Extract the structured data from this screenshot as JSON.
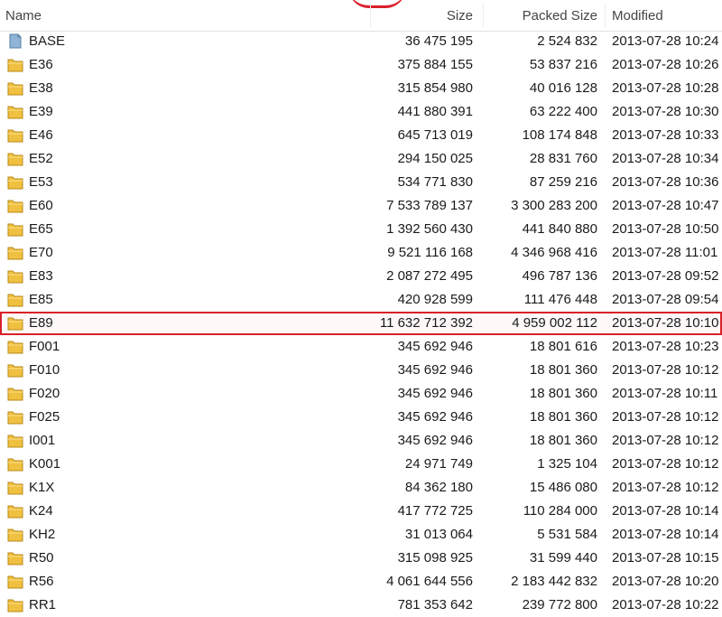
{
  "columns": {
    "name": "Name",
    "size": "Size",
    "packed_size": "Packed Size",
    "modified": "Modified"
  },
  "colors": {
    "folder": "#f0c040",
    "file": "#8fb4d6",
    "highlight": "#d9202a"
  },
  "rows": [
    {
      "name": "BASE",
      "size": "36 475 195",
      "packed": "2 524 832",
      "modified": "2013-07-28 10:24",
      "icon": "file-icon"
    },
    {
      "name": "E36",
      "size": "375 884 155",
      "packed": "53 837 216",
      "modified": "2013-07-28 10:26",
      "icon": "folder-icon"
    },
    {
      "name": "E38",
      "size": "315 854 980",
      "packed": "40 016 128",
      "modified": "2013-07-28 10:28",
      "icon": "folder-icon"
    },
    {
      "name": "E39",
      "size": "441 880 391",
      "packed": "63 222 400",
      "modified": "2013-07-28 10:30",
      "icon": "folder-icon"
    },
    {
      "name": "E46",
      "size": "645 713 019",
      "packed": "108 174 848",
      "modified": "2013-07-28 10:33",
      "icon": "folder-icon"
    },
    {
      "name": "E52",
      "size": "294 150 025",
      "packed": "28 831 760",
      "modified": "2013-07-28 10:34",
      "icon": "folder-icon"
    },
    {
      "name": "E53",
      "size": "534 771 830",
      "packed": "87 259 216",
      "modified": "2013-07-28 10:36",
      "icon": "folder-icon"
    },
    {
      "name": "E60",
      "size": "7 533 789 137",
      "packed": "3 300 283 200",
      "modified": "2013-07-28 10:47",
      "icon": "folder-icon"
    },
    {
      "name": "E65",
      "size": "1 392 560 430",
      "packed": "441 840 880",
      "modified": "2013-07-28 10:50",
      "icon": "folder-icon"
    },
    {
      "name": "E70",
      "size": "9 521 116 168",
      "packed": "4 346 968 416",
      "modified": "2013-07-28 11:01",
      "icon": "folder-icon"
    },
    {
      "name": "E83",
      "size": "2 087 272 495",
      "packed": "496 787 136",
      "modified": "2013-07-28 09:52",
      "icon": "folder-icon"
    },
    {
      "name": "E85",
      "size": "420 928 599",
      "packed": "111 476 448",
      "modified": "2013-07-28 09:54",
      "icon": "folder-icon"
    },
    {
      "name": "E89",
      "size": "11 632 712 392",
      "packed": "4 959 002 112",
      "modified": "2013-07-28 10:10",
      "icon": "folder-icon",
      "selected": true
    },
    {
      "name": "F001",
      "size": "345 692 946",
      "packed": "18 801 616",
      "modified": "2013-07-28 10:23",
      "icon": "folder-icon"
    },
    {
      "name": "F010",
      "size": "345 692 946",
      "packed": "18 801 360",
      "modified": "2013-07-28 10:12",
      "icon": "folder-icon"
    },
    {
      "name": "F020",
      "size": "345 692 946",
      "packed": "18 801 360",
      "modified": "2013-07-28 10:11",
      "icon": "folder-icon"
    },
    {
      "name": "F025",
      "size": "345 692 946",
      "packed": "18 801 360",
      "modified": "2013-07-28 10:12",
      "icon": "folder-icon"
    },
    {
      "name": "I001",
      "size": "345 692 946",
      "packed": "18 801 360",
      "modified": "2013-07-28 10:12",
      "icon": "folder-icon"
    },
    {
      "name": "K001",
      "size": "24 971 749",
      "packed": "1 325 104",
      "modified": "2013-07-28 10:12",
      "icon": "folder-icon"
    },
    {
      "name": "K1X",
      "size": "84 362 180",
      "packed": "15 486 080",
      "modified": "2013-07-28 10:12",
      "icon": "folder-icon"
    },
    {
      "name": "K24",
      "size": "417 772 725",
      "packed": "110 284 000",
      "modified": "2013-07-28 10:14",
      "icon": "folder-icon"
    },
    {
      "name": "KH2",
      "size": "31 013 064",
      "packed": "5 531 584",
      "modified": "2013-07-28 10:14",
      "icon": "folder-icon"
    },
    {
      "name": "R50",
      "size": "315 098 925",
      "packed": "31 599 440",
      "modified": "2013-07-28 10:15",
      "icon": "folder-icon"
    },
    {
      "name": "R56",
      "size": "4 061 644 556",
      "packed": "2 183 442 832",
      "modified": "2013-07-28 10:20",
      "icon": "folder-icon"
    },
    {
      "name": "RR1",
      "size": "781 353 642",
      "packed": "239 772 800",
      "modified": "2013-07-28 10:22",
      "icon": "folder-icon"
    }
  ]
}
